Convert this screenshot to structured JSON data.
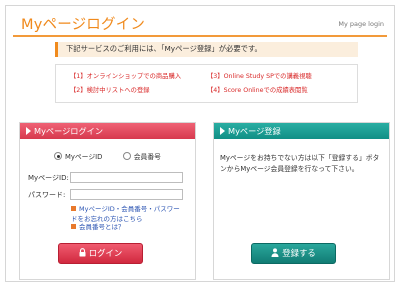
{
  "header": {
    "title": "Myページログイン",
    "top_right": "My page login"
  },
  "notice": "下記サービスのご利用には、「Myページ登録」が必要です。",
  "service_links": [
    "【1】オンラインショップでの商品購入",
    "【2】検討中リストへの登録",
    "【3】Online Study SPでの講義視聴",
    "【4】Score Onlineでの成績表閲覧"
  ],
  "login_panel": {
    "title": "Myページログイン",
    "radio_options": [
      "MyページID",
      "会員番号"
    ],
    "selected_radio": "MyページID",
    "id_label": "MyページID:",
    "password_label": "パスワード:",
    "id_value": "",
    "password_value": "",
    "help_link_1": "MyページID・会員番号・パスワードをお忘れの方はこちら",
    "help_link_2": "会員番号とは？",
    "login_button": "ログイン"
  },
  "register_panel": {
    "title": "Myページ登録",
    "description": "Myページをお持ちでない方は以下「登録する」ボタンからMyページ会員登録を行なって下さい。",
    "register_button": "登録する"
  },
  "colors": {
    "accent": "#f08a1d",
    "login_red": "#d7394e",
    "register_teal": "#118f86",
    "link_red": "#d92a2a",
    "link_blue": "#2c55b3"
  },
  "icons": {
    "lock": "lock-icon",
    "user": "user-icon",
    "triangle": "triangle-right-icon"
  }
}
